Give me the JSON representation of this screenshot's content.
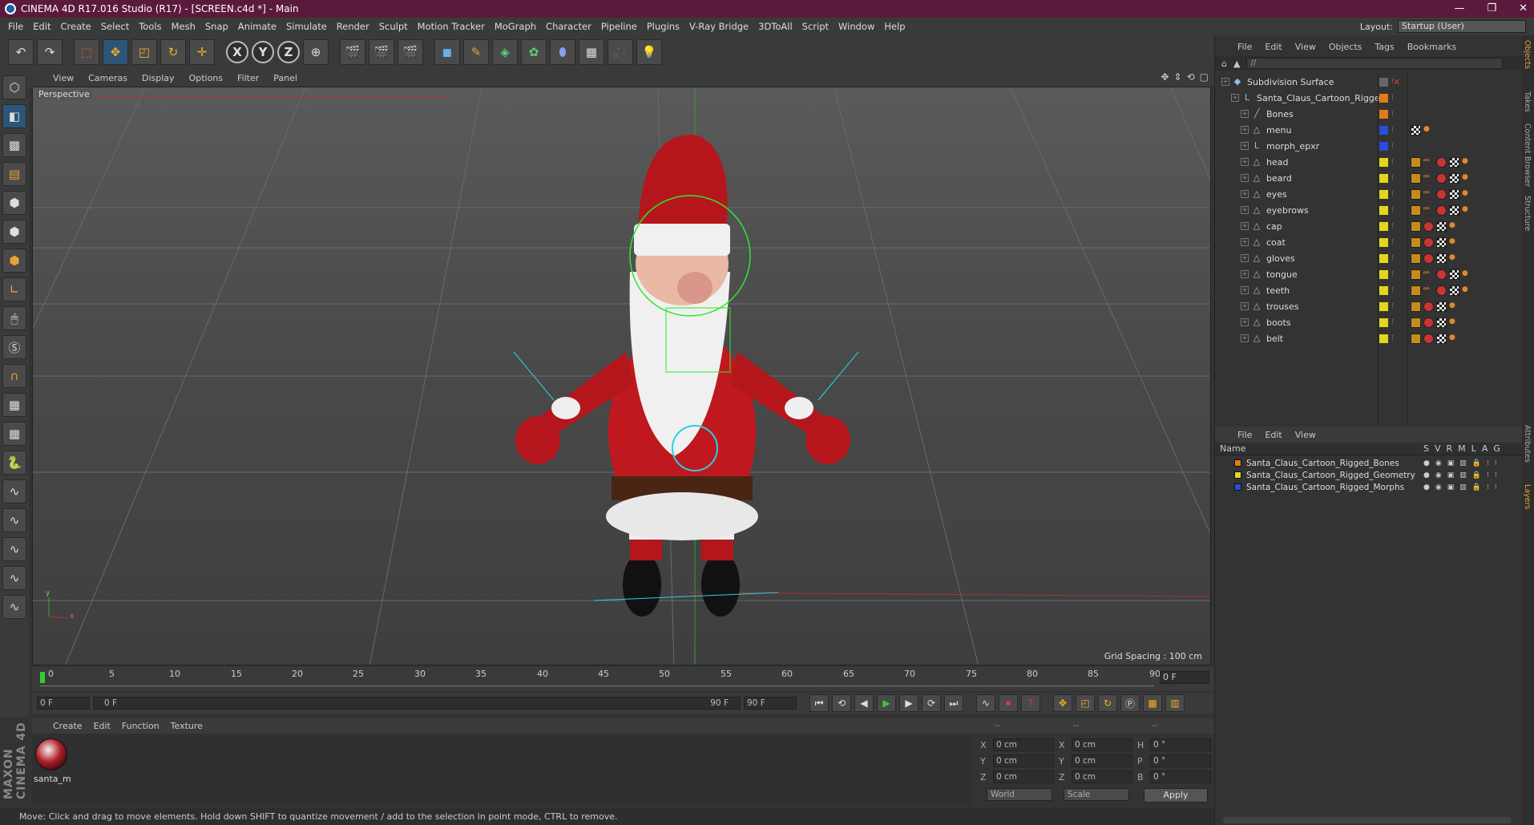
{
  "titlebar": {
    "title": "CINEMA 4D R17.016 Studio (R17) - [SCREEN.c4d *] - Main",
    "min": "—",
    "max": "❐",
    "close": "✕"
  },
  "menubar": {
    "items": [
      "File",
      "Edit",
      "Create",
      "Select",
      "Tools",
      "Mesh",
      "Snap",
      "Animate",
      "Simulate",
      "Render",
      "Sculpt",
      "Motion Tracker",
      "MoGraph",
      "Character",
      "Pipeline",
      "Plugins",
      "V-Ray Bridge",
      "3DToAll",
      "Script",
      "Window",
      "Help"
    ],
    "layout_label": "Layout:",
    "layout_value": "Startup (User)"
  },
  "toolbar": {
    "undo": "↶",
    "redo": "↷",
    "x_axis": "X",
    "y_axis": "Y",
    "z_axis": "Z"
  },
  "viewport": {
    "menu": [
      "View",
      "Cameras",
      "Display",
      "Options",
      "Filter",
      "Panel"
    ],
    "label": "Perspective",
    "grid_spacing": "Grid Spacing : 100 cm",
    "axis_y": "y",
    "axis_x": "x"
  },
  "timeline": {
    "ticks": [
      "0",
      "5",
      "10",
      "15",
      "20",
      "25",
      "30",
      "35",
      "40",
      "45",
      "50",
      "55",
      "60",
      "65",
      "70",
      "75",
      "80",
      "85",
      "90"
    ],
    "frame_end": "0 F"
  },
  "transport": {
    "start": "0 F",
    "slider_start": "0 F",
    "slider_end": "90 F",
    "end": "90 F"
  },
  "material": {
    "menu": [
      "Create",
      "Edit",
      "Function",
      "Texture"
    ],
    "name": "santa_m",
    "brand": "MAXON CINEMA 4D"
  },
  "coordinates": {
    "head": [
      "--",
      "--",
      "--"
    ],
    "rows": [
      {
        "a": "X",
        "v1": "0 cm",
        "b": "X",
        "v2": "0 cm",
        "c": "H",
        "v3": "0 °"
      },
      {
        "a": "Y",
        "v1": "0 cm",
        "b": "Y",
        "v2": "0 cm",
        "c": "P",
        "v3": "0 °"
      },
      {
        "a": "Z",
        "v1": "0 cm",
        "b": "Z",
        "v2": "0 cm",
        "c": "B",
        "v3": "0 °"
      }
    ],
    "world": "World",
    "scale": "Scale",
    "apply": "Apply"
  },
  "status": "Move: Click and drag to move elements. Hold down SHIFT to quantize movement / add to the selection in point mode, CTRL to remove.",
  "objects": {
    "menu": [
      "File",
      "Edit",
      "View",
      "Objects",
      "Tags",
      "Bookmarks"
    ],
    "path": "//",
    "rows": [
      {
        "name": "Subdivision Surface",
        "indent": 0,
        "color": "#666666",
        "icon": "◆"
      },
      {
        "name": "Santa_Claus_Cartoon_Rigged",
        "indent": 1,
        "color": "#e07b1a",
        "icon": "L"
      },
      {
        "name": "Bones",
        "indent": 2,
        "color": "#e07b1a",
        "icon": "╱"
      },
      {
        "name": "menu",
        "indent": 2,
        "color": "#2b4cd9",
        "icon": "△"
      },
      {
        "name": "morph_epxr",
        "indent": 2,
        "color": "#2b4cd9",
        "icon": "L"
      },
      {
        "name": "head",
        "indent": 2,
        "color": "#e3d61e",
        "icon": "△"
      },
      {
        "name": "beard",
        "indent": 2,
        "color": "#e3d61e",
        "icon": "△"
      },
      {
        "name": "eyes",
        "indent": 2,
        "color": "#e3d61e",
        "icon": "△"
      },
      {
        "name": "eyebrows",
        "indent": 2,
        "color": "#e3d61e",
        "icon": "△"
      },
      {
        "name": "cap",
        "indent": 2,
        "color": "#e3d61e",
        "icon": "△"
      },
      {
        "name": "coat",
        "indent": 2,
        "color": "#e3d61e",
        "icon": "△"
      },
      {
        "name": "gloves",
        "indent": 2,
        "color": "#e3d61e",
        "icon": "△"
      },
      {
        "name": "tongue",
        "indent": 2,
        "color": "#e3d61e",
        "icon": "△"
      },
      {
        "name": "teeth",
        "indent": 2,
        "color": "#e3d61e",
        "icon": "△"
      },
      {
        "name": "trouses",
        "indent": 2,
        "color": "#e3d61e",
        "icon": "△"
      },
      {
        "name": "boots",
        "indent": 2,
        "color": "#e3d61e",
        "icon": "△"
      },
      {
        "name": "belt",
        "indent": 2,
        "color": "#e3d61e",
        "icon": "△"
      }
    ]
  },
  "layers": {
    "menu": [
      "File",
      "Edit",
      "View"
    ],
    "head_name": "Name",
    "cols": [
      "S",
      "V",
      "R",
      "M",
      "L",
      "A",
      "G"
    ],
    "rows": [
      {
        "name": "Santa_Claus_Cartoon_Rigged_Bones",
        "color": "#e07b1a"
      },
      {
        "name": "Santa_Claus_Cartoon_Rigged_Geometry",
        "color": "#e3d61e"
      },
      {
        "name": "Santa_Claus_Cartoon_Rigged_Morphs",
        "color": "#2b4cd9"
      }
    ]
  },
  "sidetabs": [
    "Objects",
    "Takes",
    "Content Browser",
    "Structure",
    "Attributes",
    "Layers"
  ]
}
